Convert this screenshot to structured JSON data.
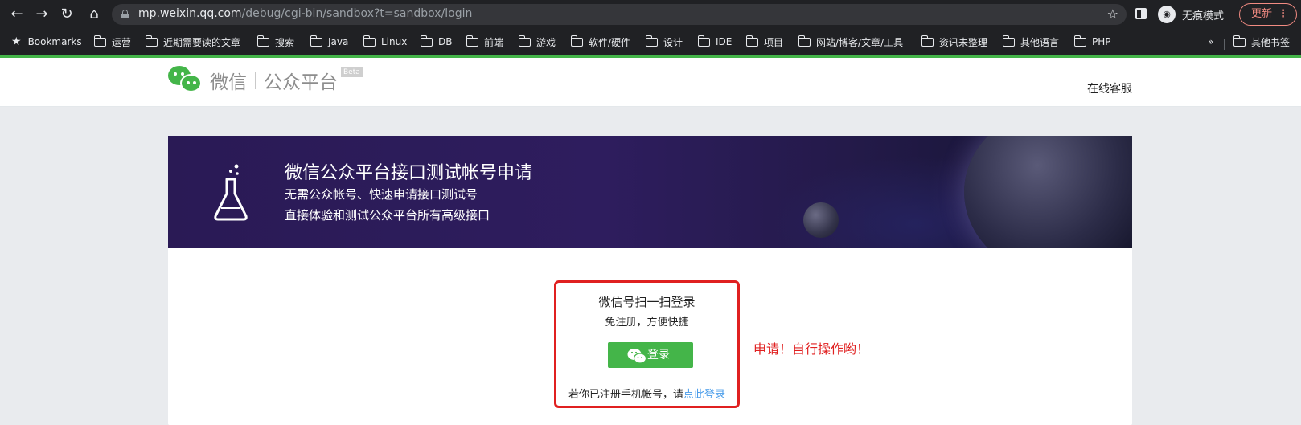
{
  "browser": {
    "url_host": "mp.weixin.qq.com",
    "url_path": "/debug/cgi-bin/sandbox?t=sandbox/login",
    "incognito_label": "无痕模式",
    "update_label": "更新",
    "bookmarks": [
      "Bookmarks",
      "运营",
      "近期需要读的文章",
      "搜索",
      "Java",
      "Linux",
      "DB",
      "前端",
      "游戏",
      "软件/硬件",
      "设计",
      "IDE",
      "项目",
      "网站/博客/文章/工具",
      "资讯未整理",
      "其他语言",
      "PHP"
    ],
    "overflow": "»",
    "other_bookmarks": "其他书签"
  },
  "header": {
    "logo_wechat": "微信",
    "logo_platform": "公众平台",
    "beta": "Beta",
    "support": "在线客服"
  },
  "banner": {
    "title": "微信公众平台接口测试帐号申请",
    "line1": "无需公众帐号、快速申请接口测试号",
    "line2": "直接体验和测试公众平台所有高级接口"
  },
  "login": {
    "title": "微信号扫一扫登录",
    "subtitle": "免注册，方便快捷",
    "button": "登录",
    "phone_prefix": "若你已注册手机帐号，请",
    "phone_link": "点此登录"
  },
  "annotation": "申请！自行操作哟！",
  "colors": {
    "brand_green": "#44b549",
    "annotation_red": "#e02020",
    "link_blue": "#459ae9"
  }
}
